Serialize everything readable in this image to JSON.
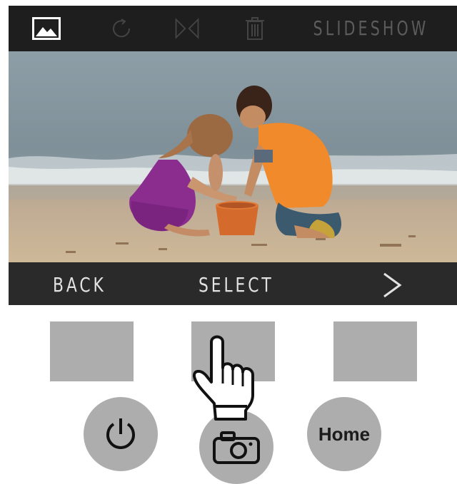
{
  "topbar": {
    "icons": [
      "image-icon",
      "rotate-icon",
      "flip-icon",
      "trash-icon"
    ],
    "slideshow_label": "SLIDESHOW"
  },
  "photo": {
    "description_icon": "photo-display"
  },
  "bottombar": {
    "back_label": "BACK",
    "select_label": "SELECT",
    "next_icon": "chevron-right-icon"
  },
  "hardware": {
    "keys": [
      "left-softkey",
      "center-softkey",
      "right-softkey"
    ],
    "power_icon": "power-icon",
    "camera_icon": "camera-icon",
    "home_label": "Home"
  },
  "colors": {
    "bar_dark": "#1e1e1e",
    "bar_bottom": "#2a2a2a",
    "inactive_icon": "#555555",
    "key_gray": "#adadad",
    "text_light": "#e2e2e2"
  }
}
